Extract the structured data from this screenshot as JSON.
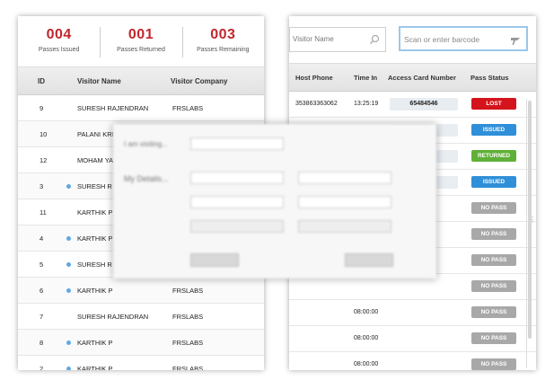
{
  "summary": {
    "issued": {
      "count": "004",
      "label": "Passes Issued"
    },
    "returned": {
      "count": "001",
      "label": "Passes Returned"
    },
    "remaining": {
      "count": "003",
      "label": "Passes Remaining"
    }
  },
  "visitors_table": {
    "headers": {
      "id": "ID",
      "name": "Visitor Name",
      "company": "Visitor Company"
    },
    "rows": [
      {
        "id": "9",
        "name": "SURESH RAJENDRAN",
        "company": "FRSLABS",
        "dot": false
      },
      {
        "id": "10",
        "name": "PALANI KRI",
        "company": "",
        "dot": false
      },
      {
        "id": "12",
        "name": "MOHAM YA",
        "company": "",
        "dot": false
      },
      {
        "id": "3",
        "name": "SURESH R",
        "company": "",
        "dot": true
      },
      {
        "id": "11",
        "name": "KARTHIK P",
        "company": "",
        "dot": false
      },
      {
        "id": "4",
        "name": "KARTHIK P",
        "company": "",
        "dot": true
      },
      {
        "id": "5",
        "name": "SURESH R",
        "company": "",
        "dot": true
      },
      {
        "id": "6",
        "name": "KARTHIK P",
        "company": "FRSLABS",
        "dot": true
      },
      {
        "id": "7",
        "name": "SURESH RAJENDRAN",
        "company": "FRSLABS",
        "dot": false
      },
      {
        "id": "8",
        "name": "KARTHIK P",
        "company": "FRSLABS",
        "dot": true
      },
      {
        "id": "2",
        "name": "KARTHIK P",
        "company": "FRSLABS",
        "dot": true
      }
    ]
  },
  "search": {
    "placeholder": "Visitor Name",
    "icon": "search-icon"
  },
  "barcode": {
    "placeholder": "Scan or enter barcode",
    "icon": "barcode-scanner-icon"
  },
  "passes_table": {
    "headers": {
      "host_phone": "Host Phone",
      "time_in": "Time In",
      "card": "Access Card Number",
      "status": "Pass Status"
    },
    "rows": [
      {
        "host_phone": "353863363062",
        "time_in": "13:25:19",
        "card": "65484546",
        "status": "LOST",
        "status_type": "lost"
      },
      {
        "host_phone": "",
        "time_in": "",
        "card": "",
        "status": "ISSUED",
        "status_type": "issued"
      },
      {
        "host_phone": "",
        "time_in": "",
        "card": "",
        "status": "RETURNED",
        "status_type": "returned"
      },
      {
        "host_phone": "",
        "time_in": "",
        "card": "",
        "status": "ISSUED",
        "status_type": "issued"
      },
      {
        "host_phone": "",
        "time_in": "",
        "card": "",
        "status": "NO PASS",
        "status_type": "nopass"
      },
      {
        "host_phone": "",
        "time_in": "",
        "card": "",
        "status": "NO PASS",
        "status_type": "nopass"
      },
      {
        "host_phone": "",
        "time_in": "",
        "card": "",
        "status": "NO PASS",
        "status_type": "nopass"
      },
      {
        "host_phone": "",
        "time_in": "",
        "card": "",
        "status": "NO PASS",
        "status_type": "nopass"
      },
      {
        "host_phone": "",
        "time_in": "08:00:00",
        "card": "",
        "status": "NO PASS",
        "status_type": "nopass"
      },
      {
        "host_phone": "",
        "time_in": "08:00:00",
        "card": "",
        "status": "NO PASS",
        "status_type": "nopass"
      },
      {
        "host_phone": "",
        "time_in": "08:00:00",
        "card": "",
        "status": "NO PASS",
        "status_type": "nopass"
      }
    ]
  },
  "modal": {
    "visiting_label": "I am visiting...",
    "details_label": "My Details..."
  },
  "colors": {
    "accent_red": "#c0272d",
    "lost": "#d4141c",
    "issued": "#2f8fd8",
    "returned": "#5fb037",
    "nopass": "#a8a8a8"
  }
}
